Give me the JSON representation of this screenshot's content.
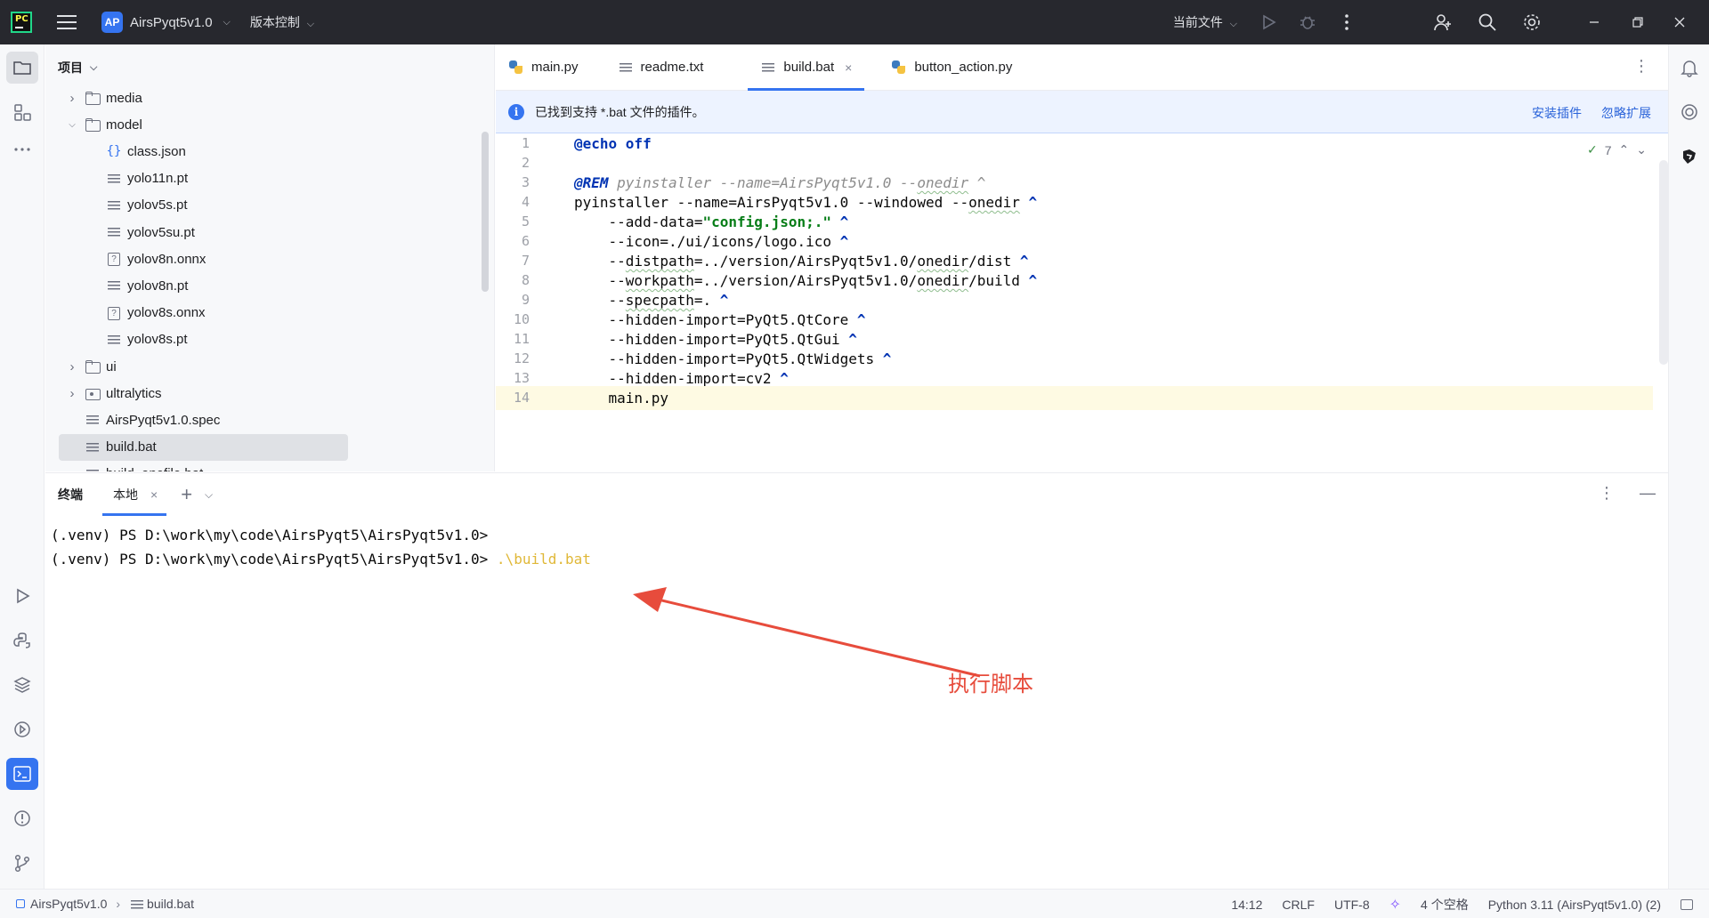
{
  "titlebar": {
    "project_badge": "AP",
    "project_name": "AirsPyqt5v1.0",
    "vcs_label": "版本控制",
    "current_file_label": "当前文件"
  },
  "project_panel": {
    "title": "项目",
    "items": [
      {
        "label": "media",
        "type": "folder",
        "depth": 1,
        "toggle": ">"
      },
      {
        "label": "model",
        "type": "folder",
        "depth": 1,
        "toggle": "v"
      },
      {
        "label": "class.json",
        "type": "json",
        "depth": 2
      },
      {
        "label": "yolo11n.pt",
        "type": "text",
        "depth": 2
      },
      {
        "label": "yolov5s.pt",
        "type": "text",
        "depth": 2
      },
      {
        "label": "yolov5su.pt",
        "type": "text",
        "depth": 2
      },
      {
        "label": "yolov8n.onnx",
        "type": "unknown",
        "depth": 2
      },
      {
        "label": "yolov8n.pt",
        "type": "text",
        "depth": 2
      },
      {
        "label": "yolov8s.onnx",
        "type": "unknown",
        "depth": 2
      },
      {
        "label": "yolov8s.pt",
        "type": "text",
        "depth": 2
      },
      {
        "label": "ui",
        "type": "folder",
        "depth": 1,
        "toggle": ">"
      },
      {
        "label": "ultralytics",
        "type": "pkg",
        "depth": 1,
        "toggle": ">"
      },
      {
        "label": "AirsPyqt5v1.0.spec",
        "type": "text",
        "depth": 1
      },
      {
        "label": "build.bat",
        "type": "text",
        "depth": 1,
        "selected": true
      },
      {
        "label": "build_onefile.bat",
        "type": "text",
        "depth": 1
      }
    ]
  },
  "editor": {
    "tabs": [
      {
        "label": "main.py",
        "icon": "python-icon"
      },
      {
        "label": "readme.txt",
        "icon": "text-file-icon"
      },
      {
        "label": "build.bat",
        "icon": "text-file-icon",
        "active": true
      },
      {
        "label": "button_action.py",
        "icon": "python-icon"
      }
    ],
    "close_glyph": "×",
    "banner": {
      "message": "已找到支持 *.bat 文件的插件。",
      "install_link": "安装插件",
      "ignore_link": "忽略扩展"
    },
    "inspection_count": "7",
    "current_line": 14,
    "lines": [
      {
        "n": "1",
        "text": "@echo off"
      },
      {
        "n": "2",
        "text": ""
      },
      {
        "n": "3",
        "text": "@REM pyinstaller --name=AirsPyqt5v1.0 --onedir ^"
      },
      {
        "n": "4",
        "text": "pyinstaller --name=AirsPyqt5v1.0 --windowed --onedir ^"
      },
      {
        "n": "5",
        "text": "    --add-data=\"config.json;.\" ^"
      },
      {
        "n": "6",
        "text": "    --icon=./ui/icons/logo.ico ^"
      },
      {
        "n": "7",
        "text": "    --distpath=../version/AirsPyqt5v1.0/onedir/dist ^"
      },
      {
        "n": "8",
        "text": "    --workpath=../version/AirsPyqt5v1.0/onedir/build ^"
      },
      {
        "n": "9",
        "text": "    --specpath=. ^"
      },
      {
        "n": "10",
        "text": "    --hidden-import=PyQt5.QtCore ^"
      },
      {
        "n": "11",
        "text": "    --hidden-import=PyQt5.QtGui ^"
      },
      {
        "n": "12",
        "text": "    --hidden-import=PyQt5.QtWidgets ^"
      },
      {
        "n": "13",
        "text": "    --hidden-import=cv2 ^"
      },
      {
        "n": "14",
        "text": "    main.py"
      }
    ]
  },
  "terminal": {
    "title": "终端",
    "tab_label": "本地",
    "prompt": "(.venv) PS D:\\work\\my\\code\\AirsPyqt5\\AirsPyqt5v1.0>",
    "command": ".\\build.bat",
    "annotation": "执行脚本"
  },
  "statusbar": {
    "project": "AirsPyqt5v1.0",
    "file": "build.bat",
    "position": "14:12",
    "line_ending": "CRLF",
    "encoding": "UTF-8",
    "indent": "4 个空格",
    "interpreter": "Python 3.11 (AirsPyqt5v1.0) (2)"
  },
  "colors": {
    "accent": "#3574f0",
    "keyword": "#0033b3",
    "string": "#067d17",
    "annotation": "#e74c3c"
  }
}
